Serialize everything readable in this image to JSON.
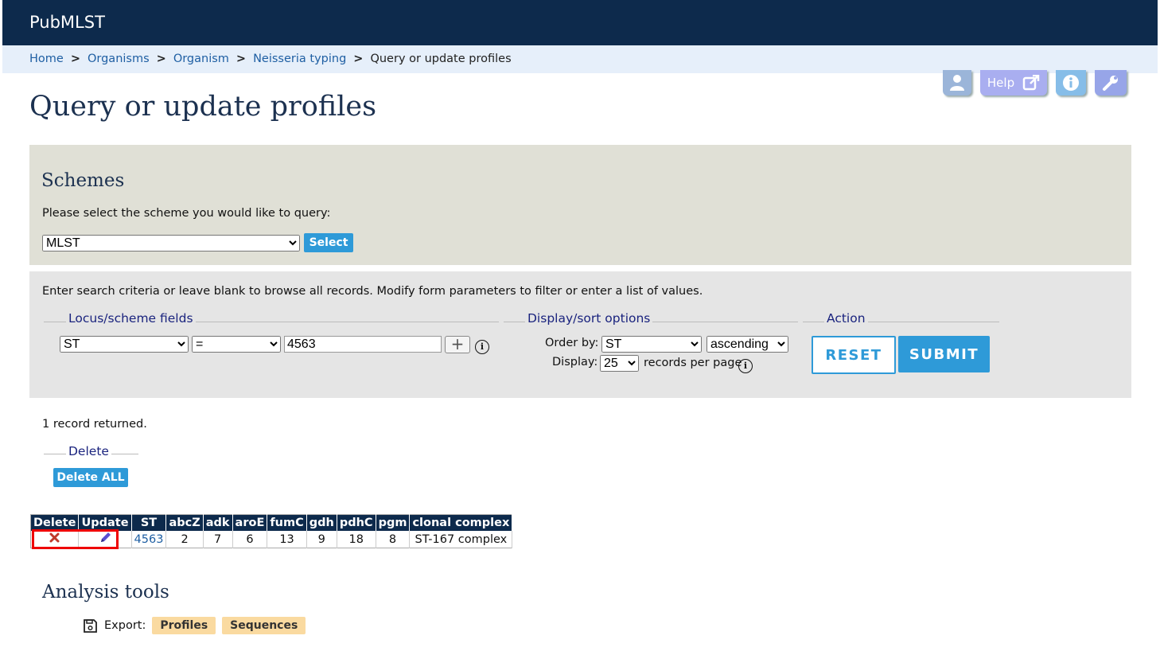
{
  "header": {
    "site_title": "PubMLST"
  },
  "breadcrumb": {
    "items": [
      "Home",
      "Organisms",
      "Organism",
      "Neisseria typing"
    ],
    "current": "Query or update profiles",
    "separator": ">"
  },
  "toolbar": {
    "help_label": "Help"
  },
  "page": {
    "title": "Query or update profiles"
  },
  "schemes": {
    "heading": "Schemes",
    "prompt": "Please select the scheme you would like to query:",
    "selected": "MLST",
    "select_button": "Select"
  },
  "search": {
    "hint": "Enter search criteria or leave blank to browse all records. Modify form parameters to filter or enter a list of values.",
    "locus_legend": "Locus/scheme fields",
    "field_selected": "ST",
    "operator_selected": "=",
    "value": "4563",
    "display_legend": "Display/sort options",
    "order_by_label": "Order by:",
    "order_by_selected": "ST",
    "direction_selected": "ascending",
    "display_label": "Display:",
    "display_selected": "25",
    "records_per_page": "records per page",
    "action_legend": "Action",
    "reset_label": "RESET",
    "submit_label": "SUBMIT"
  },
  "results": {
    "count_text": "1 record returned.",
    "delete_legend": "Delete",
    "delete_all_label": "Delete ALL",
    "columns": [
      "Delete",
      "Update",
      "ST",
      "abcZ",
      "adk",
      "aroE",
      "fumC",
      "gdh",
      "pdhC",
      "pgm",
      "clonal complex"
    ],
    "row": {
      "st": "4563",
      "abcZ": "2",
      "adk": "7",
      "aroE": "6",
      "fumC": "13",
      "gdh": "9",
      "pdhC": "18",
      "pgm": "8",
      "clonal_complex": "ST-167 complex"
    }
  },
  "analysis": {
    "heading": "Analysis tools",
    "export_label": "Export:",
    "profiles_label": "Profiles",
    "sequences_label": "Sequences"
  },
  "colors": {
    "header_bg": "#0d2a4c",
    "accent": "#2e9ad8",
    "schemes_panel": "#e0e0d6",
    "search_panel": "#e5e5e5",
    "highlight": "#ee0000"
  }
}
